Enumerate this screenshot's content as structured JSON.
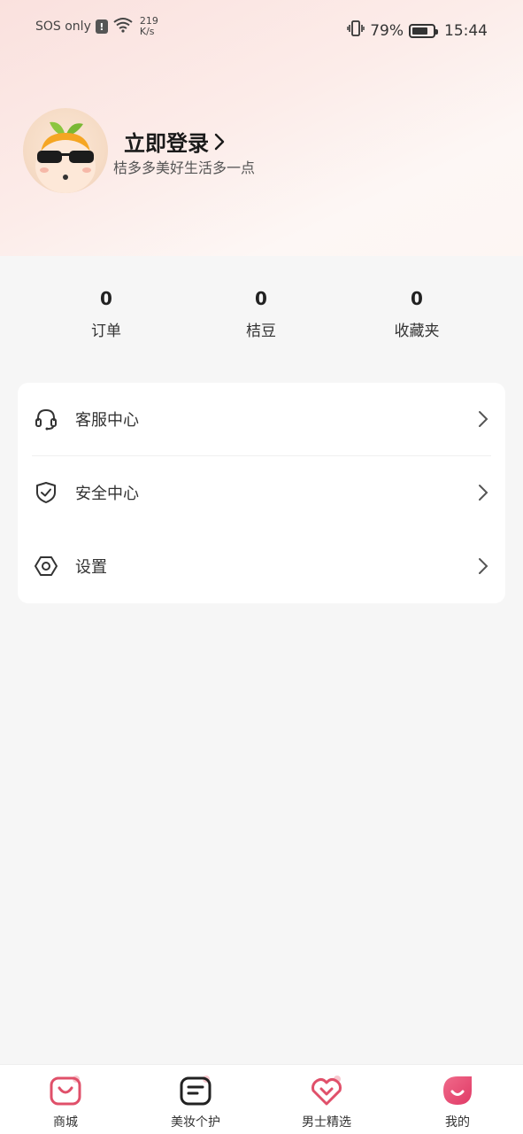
{
  "status_bar": {
    "carrier": "SOS only",
    "network_speed_value": "219",
    "network_speed_unit": "K/s",
    "battery_percent": "79%",
    "battery_level": 0.79,
    "time": "15:44"
  },
  "profile": {
    "login_label": "立即登录",
    "subtitle": "桔多多美好生活多一点"
  },
  "stats": [
    {
      "value": "0",
      "label": "订单"
    },
    {
      "value": "0",
      "label": "桔豆"
    },
    {
      "value": "0",
      "label": "收藏夹"
    }
  ],
  "menu": {
    "items": [
      {
        "label": "客服中心",
        "icon": "headset-icon"
      },
      {
        "label": "安全中心",
        "icon": "shield-check-icon"
      },
      {
        "label": "设置",
        "icon": "settings-hexagon-icon"
      }
    ]
  },
  "bottom_nav": {
    "items": [
      {
        "label": "商城",
        "icon": "shop-bag-icon"
      },
      {
        "label": "美妆个护",
        "icon": "document-icon"
      },
      {
        "label": "男士精选",
        "icon": "heart-icon"
      },
      {
        "label": "我的",
        "icon": "profile-smile-icon",
        "active": true
      }
    ]
  },
  "colors": {
    "accent": "#e8506e",
    "header_gradient_start": "#fae1de",
    "header_gradient_end": "#fdf6f3"
  }
}
